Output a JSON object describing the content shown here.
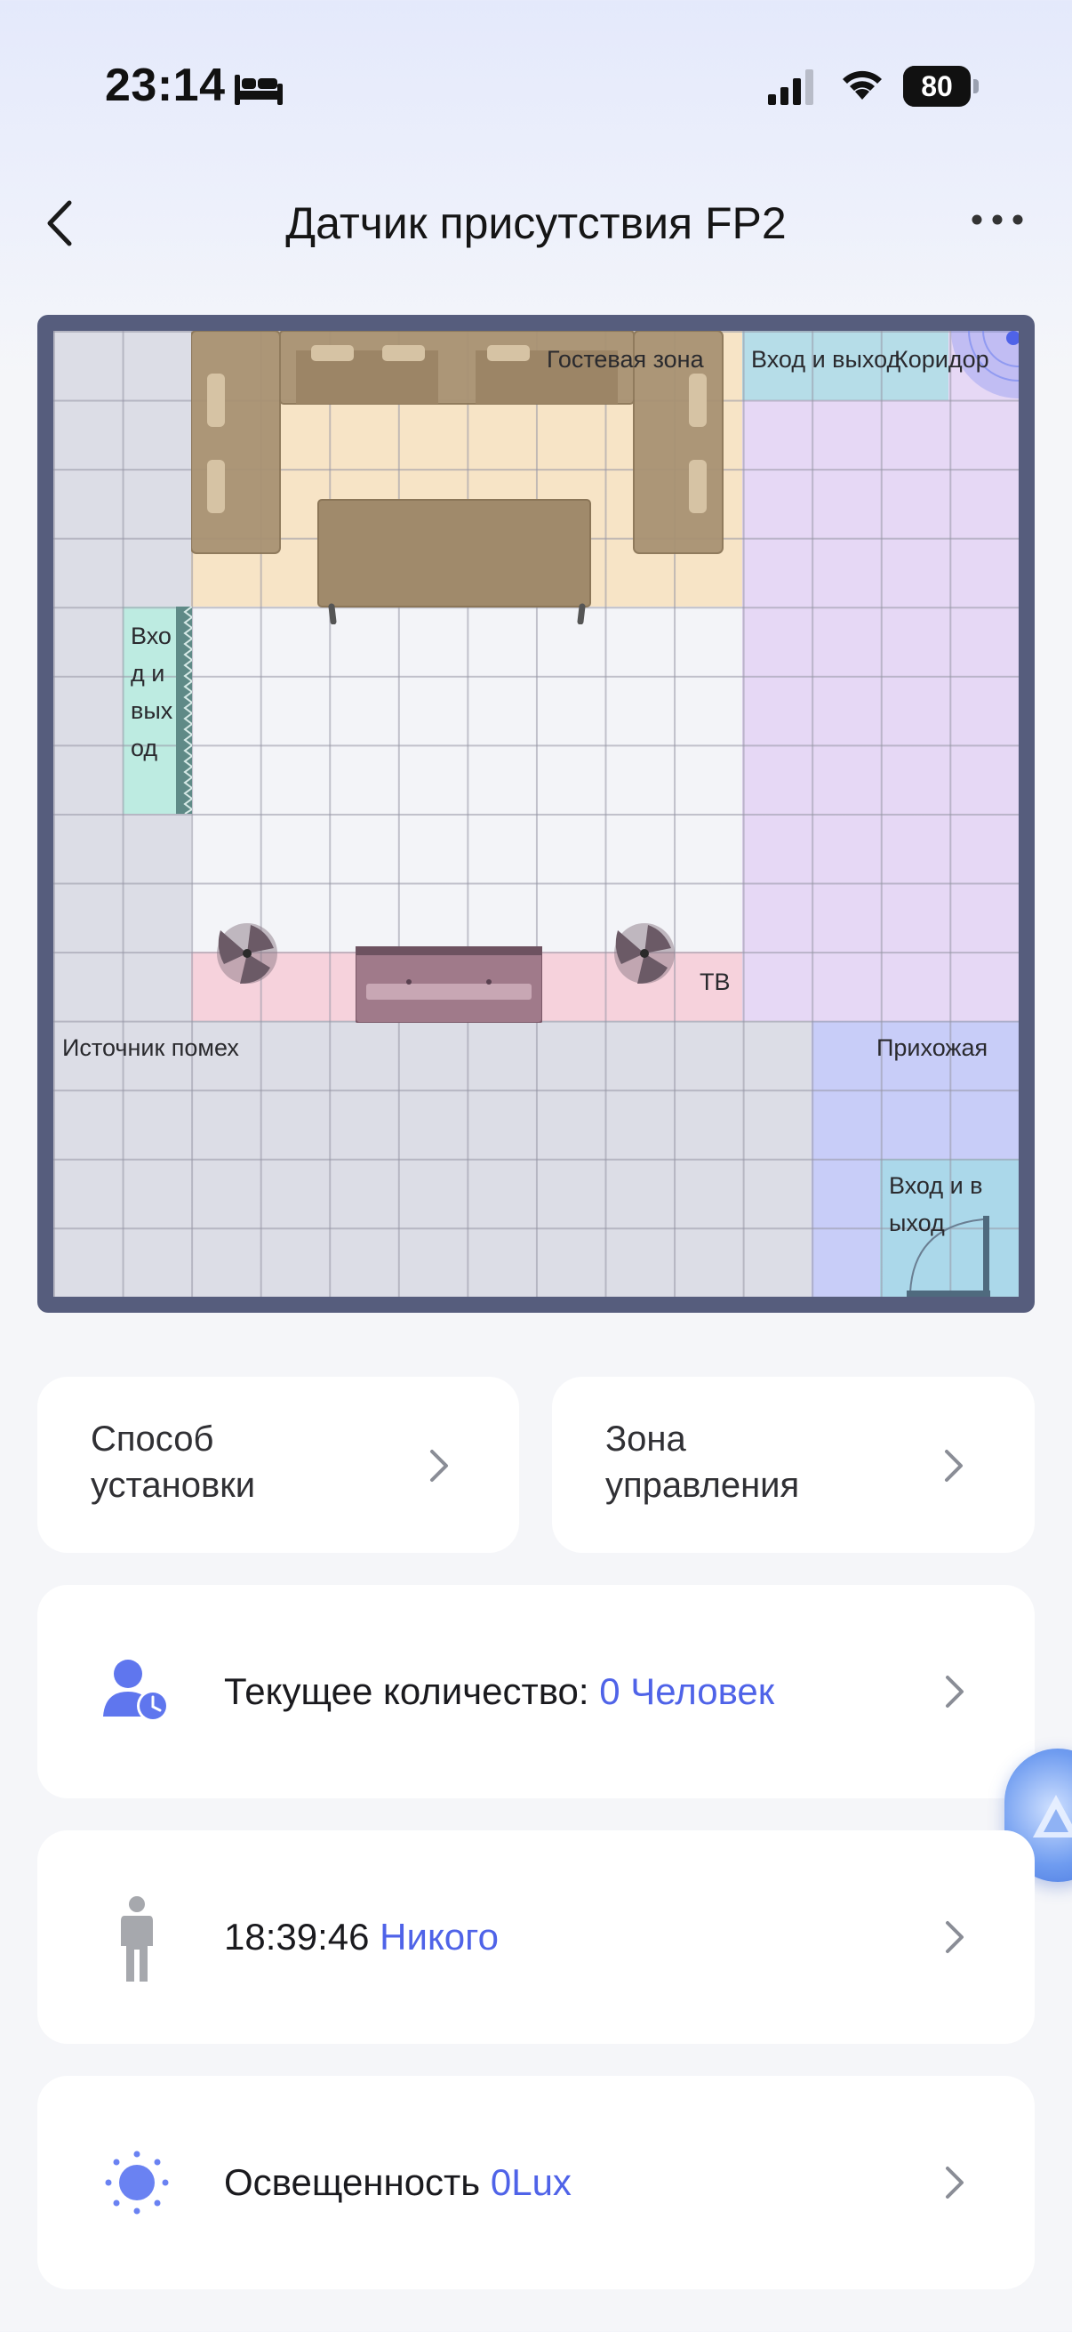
{
  "status_bar": {
    "time": "23:14",
    "battery": "80",
    "icons": [
      "bed-icon",
      "cellular-signal-icon",
      "wifi-icon",
      "battery-icon"
    ]
  },
  "header": {
    "title": "Датчик присутствия FP2",
    "back_icon": "chevron-left-icon",
    "more_icon": "more-dots-icon"
  },
  "map": {
    "zone_labels": {
      "guest": "Гостевая зона",
      "entrance_top": "Вход и выход",
      "corridor": "Коридор",
      "entrance_left": "Вхо\nд и\nвых\nод",
      "tv": "ТВ",
      "interference": "Источник помех",
      "hallway": "Прихожая",
      "entrance_bottom": "Вход и в\nыход"
    },
    "colors": {
      "guest": "#f7e4c6",
      "entrance": "#b6dde8",
      "corridor": "#e6d8f5",
      "entrance_left": "#bdebe1",
      "tv": "#f6d2dc",
      "hallway": "#c8cdf8",
      "interference": "#dcdde6",
      "room": "#f3f4f8"
    }
  },
  "cards": {
    "install": {
      "label": "Способ\nустановки"
    },
    "control_zone": {
      "label": "Зона\nуправления"
    },
    "count": {
      "label": "Текущее количество: ",
      "value": "0 Человек"
    },
    "presence": {
      "label": "18:39:46 ",
      "value": "Никого"
    },
    "light": {
      "label": "Освещенность ",
      "value": "0Lux"
    }
  },
  "accent_color": "#4f63e8"
}
